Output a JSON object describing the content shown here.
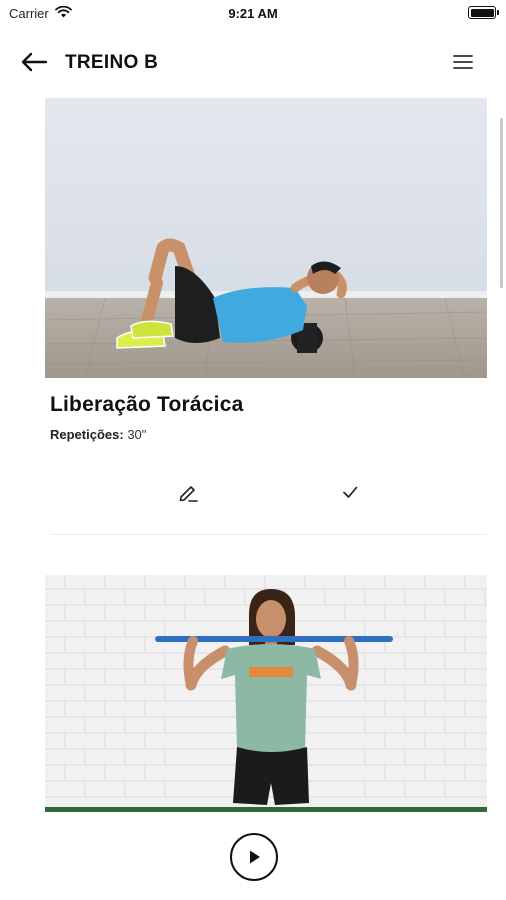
{
  "status_bar": {
    "carrier": "Carrier",
    "time": "9:21 AM",
    "icons": [
      "wifi-icon",
      "battery-icon"
    ]
  },
  "header": {
    "title": "TREINO B",
    "back_icon": "arrow-left-icon",
    "menu_icon": "hamburger-menu-icon"
  },
  "exercises": [
    {
      "title": "Liberação Torácica",
      "reps_label": "Repetições:",
      "reps_value": "30\"",
      "actions": [
        "pencil-edit-icon",
        "checkmark-icon"
      ]
    }
  ],
  "player": {
    "play_icon": "play-icon"
  },
  "colors": {
    "accent_shirt": "#3fa9e0",
    "text": "#111111",
    "divider": "#ececec"
  }
}
